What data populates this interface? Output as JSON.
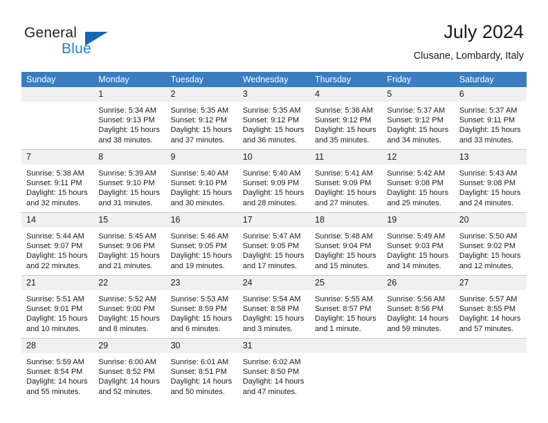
{
  "brand": {
    "name_primary": "General",
    "name_secondary": "Blue",
    "triangle_color": "#1268b3",
    "blue_color": "#1f7fd0"
  },
  "header": {
    "month_title": "July 2024",
    "location": "Clusane, Lombardy, Italy"
  },
  "calendar": {
    "header_bg": "#3a7dc0",
    "header_text_color": "#ffffff",
    "daynum_bg": "#f0f0f0",
    "weekdays": [
      "Sunday",
      "Monday",
      "Tuesday",
      "Wednesday",
      "Thursday",
      "Friday",
      "Saturday"
    ],
    "labels": {
      "sunrise": "Sunrise:",
      "sunset": "Sunset:",
      "daylight": "Daylight:"
    },
    "weeks": [
      [
        {
          "day": "",
          "sunrise": "",
          "sunset": "",
          "daylight_line1": "",
          "daylight_line2": "",
          "blank": true
        },
        {
          "day": "1",
          "sunrise": "Sunrise: 5:34 AM",
          "sunset": "Sunset: 9:13 PM",
          "daylight_line1": "Daylight: 15 hours",
          "daylight_line2": "and 38 minutes."
        },
        {
          "day": "2",
          "sunrise": "Sunrise: 5:35 AM",
          "sunset": "Sunset: 9:12 PM",
          "daylight_line1": "Daylight: 15 hours",
          "daylight_line2": "and 37 minutes."
        },
        {
          "day": "3",
          "sunrise": "Sunrise: 5:35 AM",
          "sunset": "Sunset: 9:12 PM",
          "daylight_line1": "Daylight: 15 hours",
          "daylight_line2": "and 36 minutes."
        },
        {
          "day": "4",
          "sunrise": "Sunrise: 5:36 AM",
          "sunset": "Sunset: 9:12 PM",
          "daylight_line1": "Daylight: 15 hours",
          "daylight_line2": "and 35 minutes."
        },
        {
          "day": "5",
          "sunrise": "Sunrise: 5:37 AM",
          "sunset": "Sunset: 9:12 PM",
          "daylight_line1": "Daylight: 15 hours",
          "daylight_line2": "and 34 minutes."
        },
        {
          "day": "6",
          "sunrise": "Sunrise: 5:37 AM",
          "sunset": "Sunset: 9:11 PM",
          "daylight_line1": "Daylight: 15 hours",
          "daylight_line2": "and 33 minutes."
        }
      ],
      [
        {
          "day": "7",
          "sunrise": "Sunrise: 5:38 AM",
          "sunset": "Sunset: 9:11 PM",
          "daylight_line1": "Daylight: 15 hours",
          "daylight_line2": "and 32 minutes."
        },
        {
          "day": "8",
          "sunrise": "Sunrise: 5:39 AM",
          "sunset": "Sunset: 9:10 PM",
          "daylight_line1": "Daylight: 15 hours",
          "daylight_line2": "and 31 minutes."
        },
        {
          "day": "9",
          "sunrise": "Sunrise: 5:40 AM",
          "sunset": "Sunset: 9:10 PM",
          "daylight_line1": "Daylight: 15 hours",
          "daylight_line2": "and 30 minutes."
        },
        {
          "day": "10",
          "sunrise": "Sunrise: 5:40 AM",
          "sunset": "Sunset: 9:09 PM",
          "daylight_line1": "Daylight: 15 hours",
          "daylight_line2": "and 28 minutes."
        },
        {
          "day": "11",
          "sunrise": "Sunrise: 5:41 AM",
          "sunset": "Sunset: 9:09 PM",
          "daylight_line1": "Daylight: 15 hours",
          "daylight_line2": "and 27 minutes."
        },
        {
          "day": "12",
          "sunrise": "Sunrise: 5:42 AM",
          "sunset": "Sunset: 9:08 PM",
          "daylight_line1": "Daylight: 15 hours",
          "daylight_line2": "and 25 minutes."
        },
        {
          "day": "13",
          "sunrise": "Sunrise: 5:43 AM",
          "sunset": "Sunset: 9:08 PM",
          "daylight_line1": "Daylight: 15 hours",
          "daylight_line2": "and 24 minutes."
        }
      ],
      [
        {
          "day": "14",
          "sunrise": "Sunrise: 5:44 AM",
          "sunset": "Sunset: 9:07 PM",
          "daylight_line1": "Daylight: 15 hours",
          "daylight_line2": "and 22 minutes."
        },
        {
          "day": "15",
          "sunrise": "Sunrise: 5:45 AM",
          "sunset": "Sunset: 9:06 PM",
          "daylight_line1": "Daylight: 15 hours",
          "daylight_line2": "and 21 minutes."
        },
        {
          "day": "16",
          "sunrise": "Sunrise: 5:46 AM",
          "sunset": "Sunset: 9:05 PM",
          "daylight_line1": "Daylight: 15 hours",
          "daylight_line2": "and 19 minutes."
        },
        {
          "day": "17",
          "sunrise": "Sunrise: 5:47 AM",
          "sunset": "Sunset: 9:05 PM",
          "daylight_line1": "Daylight: 15 hours",
          "daylight_line2": "and 17 minutes."
        },
        {
          "day": "18",
          "sunrise": "Sunrise: 5:48 AM",
          "sunset": "Sunset: 9:04 PM",
          "daylight_line1": "Daylight: 15 hours",
          "daylight_line2": "and 15 minutes."
        },
        {
          "day": "19",
          "sunrise": "Sunrise: 5:49 AM",
          "sunset": "Sunset: 9:03 PM",
          "daylight_line1": "Daylight: 15 hours",
          "daylight_line2": "and 14 minutes."
        },
        {
          "day": "20",
          "sunrise": "Sunrise: 5:50 AM",
          "sunset": "Sunset: 9:02 PM",
          "daylight_line1": "Daylight: 15 hours",
          "daylight_line2": "and 12 minutes."
        }
      ],
      [
        {
          "day": "21",
          "sunrise": "Sunrise: 5:51 AM",
          "sunset": "Sunset: 9:01 PM",
          "daylight_line1": "Daylight: 15 hours",
          "daylight_line2": "and 10 minutes."
        },
        {
          "day": "22",
          "sunrise": "Sunrise: 5:52 AM",
          "sunset": "Sunset: 9:00 PM",
          "daylight_line1": "Daylight: 15 hours",
          "daylight_line2": "and 8 minutes."
        },
        {
          "day": "23",
          "sunrise": "Sunrise: 5:53 AM",
          "sunset": "Sunset: 8:59 PM",
          "daylight_line1": "Daylight: 15 hours",
          "daylight_line2": "and 6 minutes."
        },
        {
          "day": "24",
          "sunrise": "Sunrise: 5:54 AM",
          "sunset": "Sunset: 8:58 PM",
          "daylight_line1": "Daylight: 15 hours",
          "daylight_line2": "and 3 minutes."
        },
        {
          "day": "25",
          "sunrise": "Sunrise: 5:55 AM",
          "sunset": "Sunset: 8:57 PM",
          "daylight_line1": "Daylight: 15 hours",
          "daylight_line2": "and 1 minute."
        },
        {
          "day": "26",
          "sunrise": "Sunrise: 5:56 AM",
          "sunset": "Sunset: 8:56 PM",
          "daylight_line1": "Daylight: 14 hours",
          "daylight_line2": "and 59 minutes."
        },
        {
          "day": "27",
          "sunrise": "Sunrise: 5:57 AM",
          "sunset": "Sunset: 8:55 PM",
          "daylight_line1": "Daylight: 14 hours",
          "daylight_line2": "and 57 minutes."
        }
      ],
      [
        {
          "day": "28",
          "sunrise": "Sunrise: 5:59 AM",
          "sunset": "Sunset: 8:54 PM",
          "daylight_line1": "Daylight: 14 hours",
          "daylight_line2": "and 55 minutes."
        },
        {
          "day": "29",
          "sunrise": "Sunrise: 6:00 AM",
          "sunset": "Sunset: 8:52 PM",
          "daylight_line1": "Daylight: 14 hours",
          "daylight_line2": "and 52 minutes."
        },
        {
          "day": "30",
          "sunrise": "Sunrise: 6:01 AM",
          "sunset": "Sunset: 8:51 PM",
          "daylight_line1": "Daylight: 14 hours",
          "daylight_line2": "and 50 minutes."
        },
        {
          "day": "31",
          "sunrise": "Sunrise: 6:02 AM",
          "sunset": "Sunset: 8:50 PM",
          "daylight_line1": "Daylight: 14 hours",
          "daylight_line2": "and 47 minutes."
        },
        {
          "day": "",
          "sunrise": "",
          "sunset": "",
          "daylight_line1": "",
          "daylight_line2": "",
          "blank": true
        },
        {
          "day": "",
          "sunrise": "",
          "sunset": "",
          "daylight_line1": "",
          "daylight_line2": "",
          "blank": true
        },
        {
          "day": "",
          "sunrise": "",
          "sunset": "",
          "daylight_line1": "",
          "daylight_line2": "",
          "blank": true
        }
      ]
    ]
  }
}
